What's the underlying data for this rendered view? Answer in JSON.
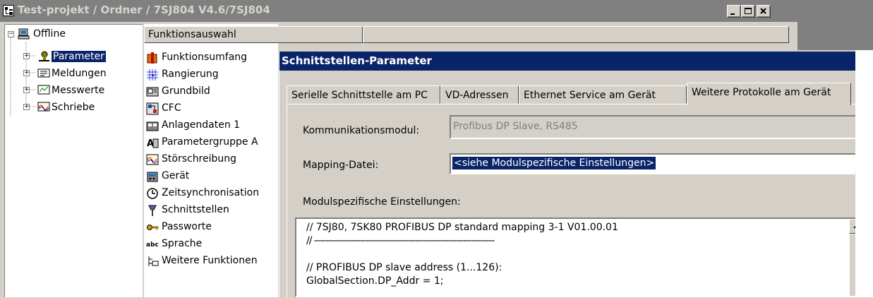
{
  "window": {
    "title": "Test-projekt / Ordner / 7SJ804 V4.6/7SJ804"
  },
  "tree": {
    "root": {
      "label": "Offline",
      "icon": "computer-icon"
    },
    "items": [
      {
        "label": "Parameter",
        "icon": "parameter-icon",
        "selected": true
      },
      {
        "label": "Meldungen",
        "icon": "messages-icon"
      },
      {
        "label": "Messwerte",
        "icon": "measurements-icon"
      },
      {
        "label": "Schriebe",
        "icon": "chart-records-icon"
      }
    ]
  },
  "functions": {
    "header": "Funktionsauswahl",
    "items": [
      {
        "label": "Funktionsumfang",
        "icon": "function-scope-icon"
      },
      {
        "label": "Rangierung",
        "icon": "matrix-icon"
      },
      {
        "label": "Grundbild",
        "icon": "default-display-icon"
      },
      {
        "label": "CFC",
        "icon": "cfc-icon"
      },
      {
        "label": "Anlagendaten 1",
        "icon": "plant-data-icon"
      },
      {
        "label": "Parametergruppe A",
        "icon": "parameter-group-icon"
      },
      {
        "label": "Störschreibung",
        "icon": "fault-recording-icon"
      },
      {
        "label": "Gerät",
        "icon": "device-icon"
      },
      {
        "label": "Zeitsynchronisation",
        "icon": "time-sync-icon"
      },
      {
        "label": "Schnittstellen",
        "icon": "interfaces-icon"
      },
      {
        "label": "Passworte",
        "icon": "key-icon"
      },
      {
        "label": "Sprache",
        "icon": "language-icon"
      },
      {
        "label": "Weitere Funktionen",
        "icon": "more-functions-icon"
      }
    ]
  },
  "dialog": {
    "title": "Schnittstellen-Parameter",
    "tabs": [
      "Serielle Schnittstelle am PC",
      "VD-Adressen",
      "Ethernet Service am Gerät",
      "Weitere Protokolle am Gerät"
    ],
    "active_tab": "Weitere Protokolle am Gerät",
    "comm_module": {
      "label": "Kommunikationsmodul:",
      "value": "Profibus DP Slave, RS485"
    },
    "mapping": {
      "label": "Mapping-Datei:",
      "value": "<siehe Modulspezifische Einstellungen>"
    },
    "module_settings": {
      "label": "Modulspezifische Einstellungen:",
      "lines": [
        "// 7SJ80, 7SK80 PROFIBUS DP standard mapping 3-1 V01.00.01",
        "// ---------------------------------------------------------------",
        "",
        "// PROFIBUS DP slave address (1...126):",
        "GlobalSection.DP_Addr = 1;"
      ]
    }
  },
  "colors": {
    "face": "#d4d0c8",
    "selection": "#0a246a",
    "inactive_title": "#808080"
  }
}
